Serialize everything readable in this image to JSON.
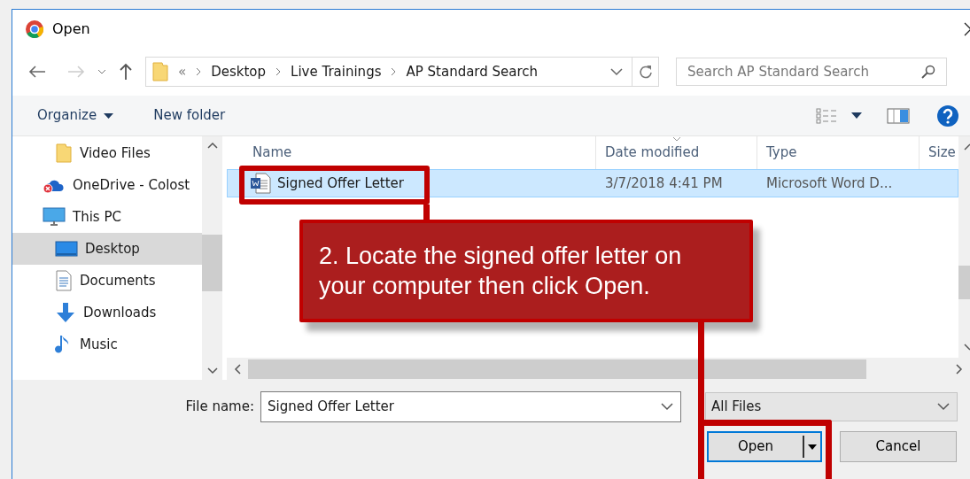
{
  "window": {
    "title": "Open"
  },
  "nav": {
    "path": [
      "«",
      "Desktop",
      "Live Trainings",
      "AP Standard Search"
    ],
    "search_placeholder": "Search AP Standard Search"
  },
  "toolbar": {
    "organize": "Organize",
    "new_folder": "New folder"
  },
  "sidebar": {
    "items": [
      {
        "children": [
          {
            "label": "Video Files",
            "kind": "folder",
            "selected": false
          }
        ]
      },
      {
        "label": "OneDrive - Colost",
        "kind": "onedrive",
        "selected": false
      },
      {
        "label": "This PC",
        "kind": "pc",
        "selected": false,
        "children": [
          {
            "label": "Desktop",
            "kind": "desktop",
            "selected": true
          },
          {
            "label": "Documents",
            "kind": "documents",
            "selected": false
          },
          {
            "label": "Downloads",
            "kind": "downloads",
            "selected": false
          },
          {
            "label": "Music",
            "kind": "music",
            "selected": false
          }
        ]
      }
    ]
  },
  "table": {
    "columns": [
      {
        "label": "Name",
        "sorted": false
      },
      {
        "label": "Date modified",
        "sorted": true
      },
      {
        "label": "Type",
        "sorted": false
      },
      {
        "label": "Size",
        "sorted": false
      }
    ],
    "rows": [
      {
        "cells": [
          "Signed Offer Letter",
          "3/7/2018 4:41 PM",
          "Microsoft Word D..."
        ],
        "selected": true
      }
    ]
  },
  "footer": {
    "file_name_label": "File name:",
    "file_name": "Signed Offer Letter",
    "filter": "All Files",
    "buttons": [
      {
        "label": "Open",
        "kind": "split"
      },
      {
        "label": "Cancel",
        "kind": "plain"
      }
    ]
  },
  "callout": {
    "text": "2. Locate the signed offer letter on your computer then click Open."
  }
}
